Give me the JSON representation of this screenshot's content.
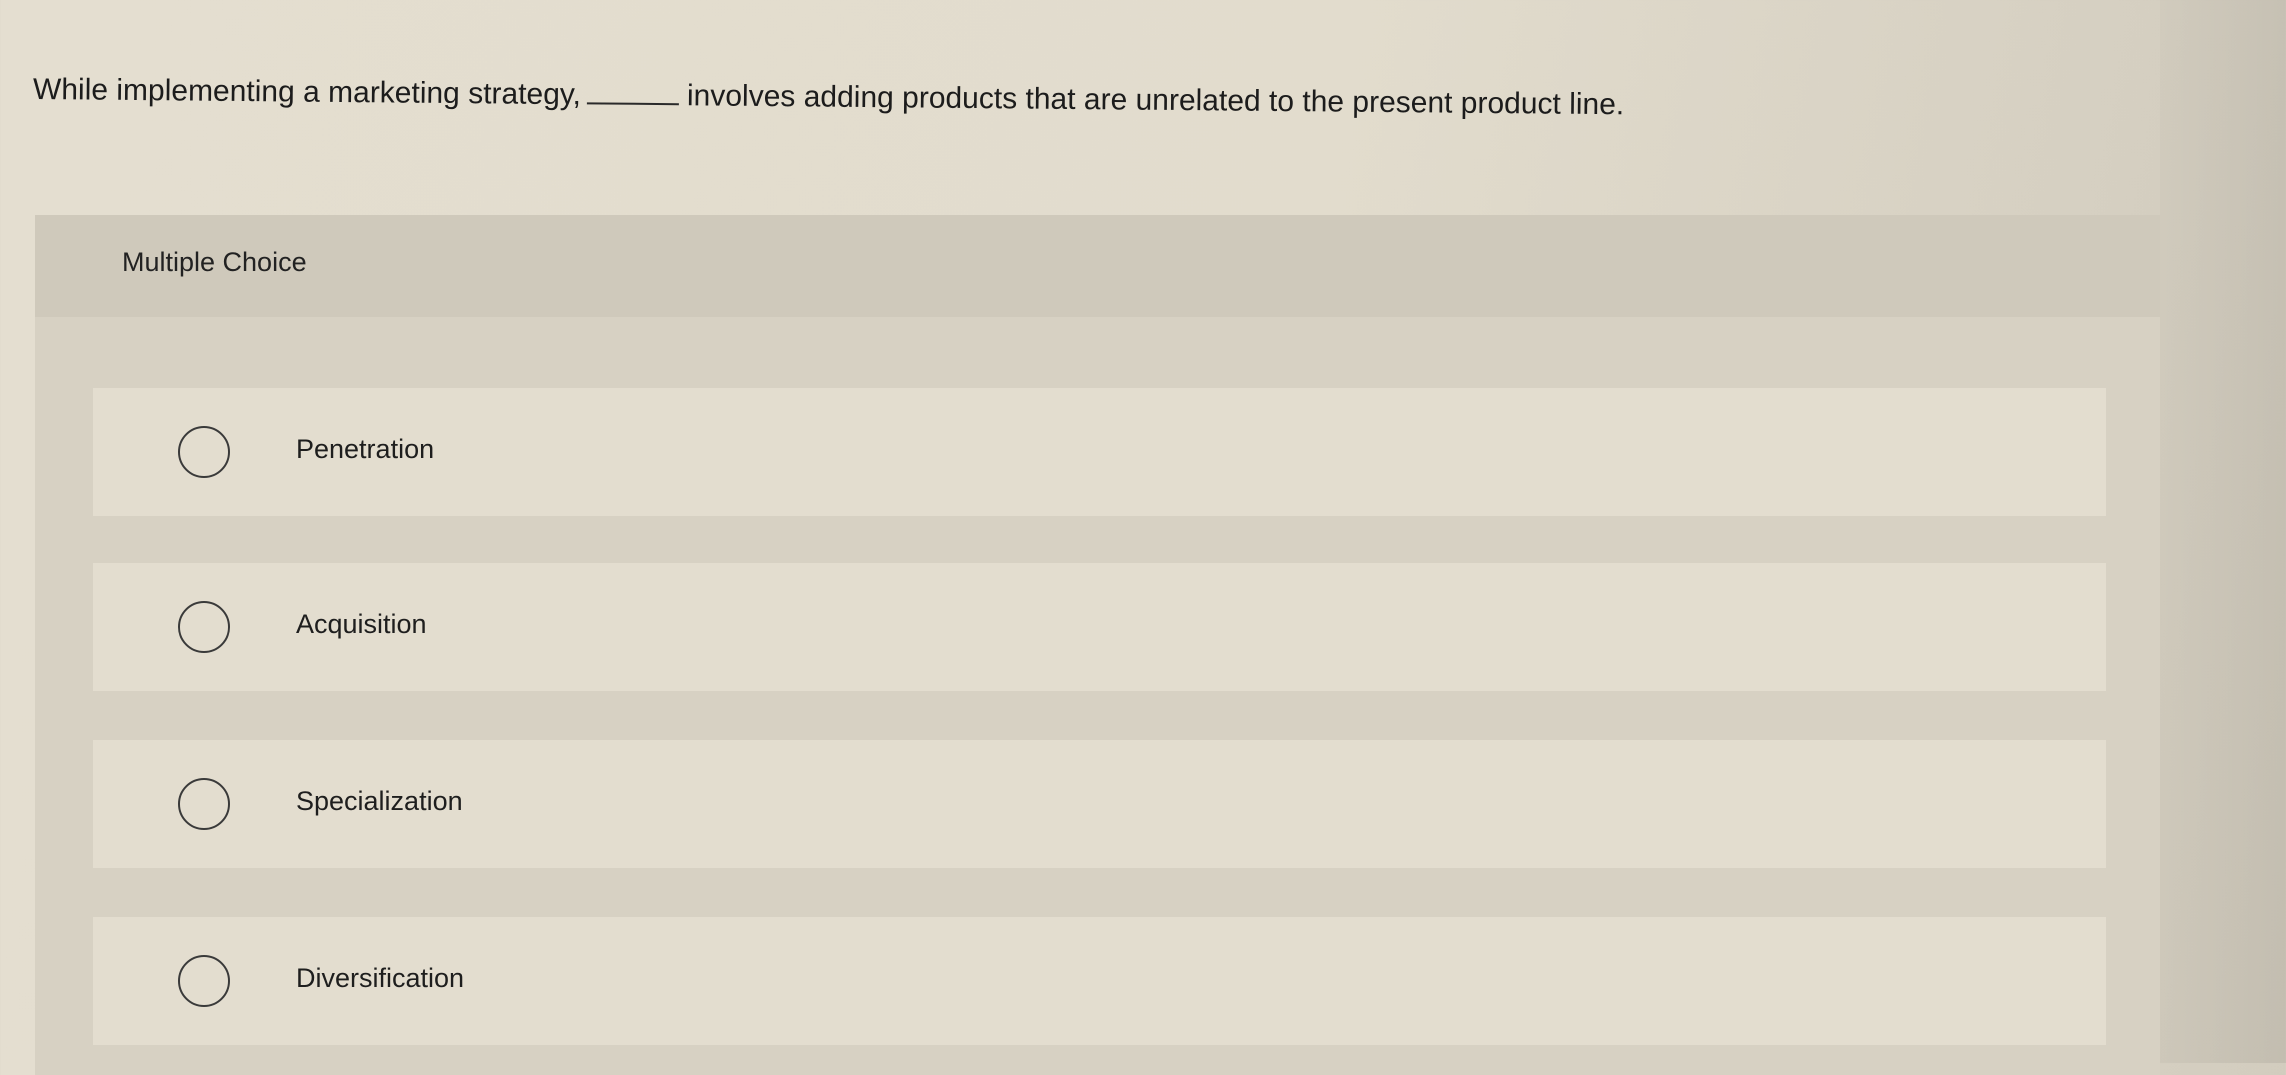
{
  "question": {
    "text_before": "While implementing a marketing strategy,",
    "text_after": "involves adding products that are unrelated to the present product line."
  },
  "multiple_choice": {
    "title": "Multiple Choice",
    "options": [
      {
        "label": "Penetration",
        "selected": false
      },
      {
        "label": "Acquisition",
        "selected": false
      },
      {
        "label": "Specialization",
        "selected": false
      },
      {
        "label": "Diversification",
        "selected": false
      }
    ]
  }
}
